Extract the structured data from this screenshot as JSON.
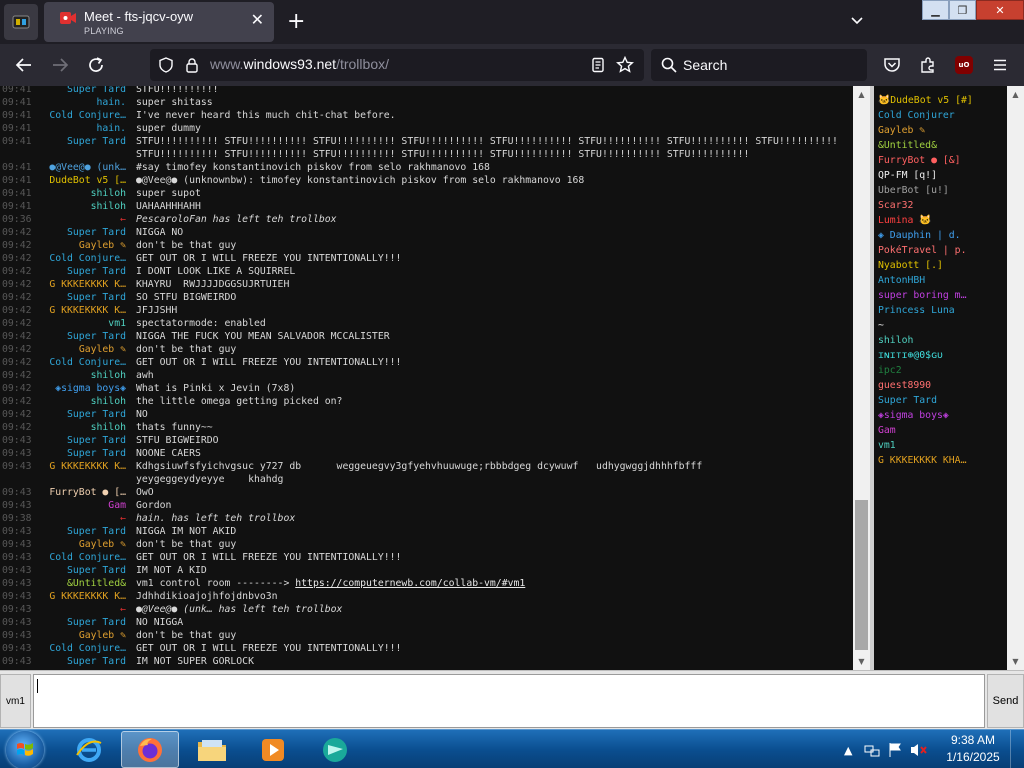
{
  "browser": {
    "tab_title": "Meet - fts-jqcv-oyw",
    "tab_status": "PLAYING",
    "url_prefix": "www.",
    "url_host": "windows93.net",
    "url_path": "/trollbox/",
    "search_placeholder": "Search",
    "ublock_label": "uO"
  },
  "chat": {
    "messages": [
      {
        "time": "09:41",
        "nick": "Super Tard",
        "color": "#2fa6d8",
        "text": "STFU!!!!!!!!!!"
      },
      {
        "time": "09:41",
        "nick": "hain.",
        "color": "#2fa6d8",
        "text": "super shitass"
      },
      {
        "time": "09:41",
        "nick": "Cold Conjure…",
        "color": "#2fa6d8",
        "text": "I've never heard this much chit-chat before."
      },
      {
        "time": "09:41",
        "nick": "hain.",
        "color": "#2fa6d8",
        "text": "super dummy"
      },
      {
        "time": "09:41",
        "nick": "Super Tard",
        "color": "#2fa6d8",
        "text": "STFU!!!!!!!!!! STFU!!!!!!!!!! STFU!!!!!!!!!! STFU!!!!!!!!!! STFU!!!!!!!!!! STFU!!!!!!!!!! STFU!!!!!!!!!! STFU!!!!!!!!!!"
      },
      {
        "time": "",
        "nick": "",
        "color": "#2fa6d8",
        "text": "STFU!!!!!!!!!! STFU!!!!!!!!!! STFU!!!!!!!!!! STFU!!!!!!!!!! STFU!!!!!!!!!! STFU!!!!!!!!!! STFU!!!!!!!!!!"
      },
      {
        "time": "09:41",
        "nick": "●@Vee@● (unk…",
        "color": "#4fa3e0",
        "text": "#say timofey konstantinovich piskov from selo rakhmanovo 168"
      },
      {
        "time": "09:41",
        "nick": "DudeBot v5 […",
        "color": "#e0c000",
        "text": "●@Vee@● (unknownbw): timofey konstantinovich piskov from selo rakhmanovo 168"
      },
      {
        "time": "09:41",
        "nick": "shiloh",
        "color": "#4fd0c0",
        "text": "super supot"
      },
      {
        "time": "09:41",
        "nick": "shiloh",
        "color": "#4fd0c0",
        "text": "UAHAAHHHAHH"
      },
      {
        "time": "09:36",
        "nick": "←",
        "color": "#e03030",
        "text": "PescaroloFan has left teh trollbox",
        "event": true
      },
      {
        "time": "09:42",
        "nick": "Super Tard",
        "color": "#2fa6d8",
        "text": "NIGGA NO"
      },
      {
        "time": "09:42",
        "nick": "Gayleb ✎",
        "color": "#e0a030",
        "text": "don't be that guy"
      },
      {
        "time": "09:42",
        "nick": "Cold Conjure…",
        "color": "#2fa6d8",
        "text": "GET OUT OR I WILL FREEZE YOU INTENTIONALLY!!!"
      },
      {
        "time": "09:42",
        "nick": "Super Tard",
        "color": "#2fa6d8",
        "text": "I DONT LOOK LIKE A SQUIRREL"
      },
      {
        "time": "09:42",
        "nick": "G KKKEKKKK K…",
        "color": "#e0a020",
        "text": "KHAYRU  RWJJJJDGGSUJRTUIEH"
      },
      {
        "time": "09:42",
        "nick": "Super Tard",
        "color": "#2fa6d8",
        "text": "SO STFU BIGWEIRDO"
      },
      {
        "time": "09:42",
        "nick": "G KKKEKKKK K…",
        "color": "#e0a020",
        "text": "JFJJSHH"
      },
      {
        "time": "09:42",
        "nick": "vm1",
        "color": "#4fd0c0",
        "text": "spectatormode: enabled"
      },
      {
        "time": "09:42",
        "nick": "Super Tard",
        "color": "#2fa6d8",
        "text": "NIGGA THE FUCK YOU MEAN SALVADOR MCCALISTER"
      },
      {
        "time": "09:42",
        "nick": "Gayleb ✎",
        "color": "#e0a030",
        "text": "don't be that guy"
      },
      {
        "time": "09:42",
        "nick": "Cold Conjure…",
        "color": "#2fa6d8",
        "text": "GET OUT OR I WILL FREEZE YOU INTENTIONALLY!!!"
      },
      {
        "time": "09:42",
        "nick": "shiloh",
        "color": "#4fd0c0",
        "text": "awh"
      },
      {
        "time": "09:42",
        "nick": "◈sigma boys◈",
        "color": "#40a0f0",
        "text": "What is Pinki x Jevin (7x8)"
      },
      {
        "time": "09:42",
        "nick": "shiloh",
        "color": "#4fd0c0",
        "text": "the little omega getting picked on?"
      },
      {
        "time": "09:42",
        "nick": "Super Tard",
        "color": "#2fa6d8",
        "text": "NO"
      },
      {
        "time": "09:42",
        "nick": "shiloh",
        "color": "#4fd0c0",
        "text": "thats funny~~"
      },
      {
        "time": "09:43",
        "nick": "Super Tard",
        "color": "#2fa6d8",
        "text": "STFU BIGWEIRDO"
      },
      {
        "time": "09:43",
        "nick": "Super Tard",
        "color": "#2fa6d8",
        "text": "NOONE CAERS"
      },
      {
        "time": "09:43",
        "nick": "G KKKEKKKK K…",
        "color": "#e0a020",
        "text": "Kdhgsiuwfsfyichvgsuc y727 db      weggeuegvy3gfyehvhuuwuge;rbbbdgeg dcywuwf   udhygwggjdhhhfbfff"
      },
      {
        "time": "",
        "nick": "",
        "color": "#e0a020",
        "text": "yeygeggeydyeyye    khahdg"
      },
      {
        "time": "09:43",
        "nick": "FurryBot ● […",
        "color": "#f0d0b0",
        "text": "OwO"
      },
      {
        "time": "09:43",
        "nick": "Gam",
        "color": "#d040d0",
        "text": "Gordon"
      },
      {
        "time": "09:38",
        "nick": "←",
        "color": "#e03030",
        "text": "hain. has left teh trollbox",
        "event": true
      },
      {
        "time": "09:43",
        "nick": "Super Tard",
        "color": "#2fa6d8",
        "text": "NIGGA IM NOT AKID"
      },
      {
        "time": "09:43",
        "nick": "Gayleb ✎",
        "color": "#e0a030",
        "text": "don't be that guy"
      },
      {
        "time": "09:43",
        "nick": "Cold Conjure…",
        "color": "#2fa6d8",
        "text": "GET OUT OR I WILL FREEZE YOU INTENTIONALLY!!!"
      },
      {
        "time": "09:43",
        "nick": "Super Tard",
        "color": "#2fa6d8",
        "text": "IM NOT A KID"
      },
      {
        "time": "09:43",
        "nick": "&Untitled&",
        "color": "#a0d040",
        "text": "vm1 control room --------> ",
        "link": "https://computernewb.com/collab-vm/#vm1"
      },
      {
        "time": "09:43",
        "nick": "G KKKEKKKK K…",
        "color": "#e0a020",
        "text": "Jdhhdikioajojhfojdnbvo3n"
      },
      {
        "time": "09:43",
        "nick": "←",
        "color": "#e03030",
        "text": "●@Vee@● (unk… has left teh trollbox",
        "event": true
      },
      {
        "time": "09:43",
        "nick": "Super Tard",
        "color": "#2fa6d8",
        "text": "NO NIGGA"
      },
      {
        "time": "09:43",
        "nick": "Gayleb ✎",
        "color": "#e0a030",
        "text": "don't be that guy"
      },
      {
        "time": "09:43",
        "nick": "Cold Conjure…",
        "color": "#2fa6d8",
        "text": "GET OUT OR I WILL FREEZE YOU INTENTIONALLY!!!"
      },
      {
        "time": "09:43",
        "nick": "Super Tard",
        "color": "#2fa6d8",
        "text": "IM NOT SUPER GORLOCK"
      }
    ]
  },
  "users": [
    {
      "name": "🐱DudeBot v5 [#]",
      "color": "#e0c000"
    },
    {
      "name": "Cold Conjurer",
      "color": "#2fa6d8"
    },
    {
      "name": "Gayleb ✎",
      "color": "#e0a030"
    },
    {
      "name": "&Untitled&",
      "color": "#a0d040"
    },
    {
      "name": "FurryBot ● [&]",
      "color": "#ff6060"
    },
    {
      "name": "QP-FM [q!]",
      "color": "#f0f0f0"
    },
    {
      "name": "UberBot [u!]",
      "color": "#a0a0a0"
    },
    {
      "name": "Scar32",
      "color": "#ff7070"
    },
    {
      "name": "Lumina 🐱",
      "color": "#ff4040"
    },
    {
      "name": "◈ Dauphin | d.",
      "color": "#40a0f0"
    },
    {
      "name": "PokéTravel | p.",
      "color": "#ff7070"
    },
    {
      "name": "Nyabott [.]",
      "color": "#e0c000"
    },
    {
      "name": "AntonHBH",
      "color": "#2fa6d8"
    },
    {
      "name": "super boring m…",
      "color": "#c040e0"
    },
    {
      "name": "Princess Luna",
      "color": "#2fa6d8"
    },
    {
      "name": "~",
      "color": "#f0f0f0"
    },
    {
      "name": "shiloh",
      "color": "#4fd0c0"
    },
    {
      "name": "ɪɴɪᴛɪ⊕@0$ɢᴜ",
      "color": "#40e0e0"
    },
    {
      "name": "ipc2",
      "color": "#208040"
    },
    {
      "name": "guest8990",
      "color": "#ff7070"
    },
    {
      "name": "Super Tard",
      "color": "#2fa6d8"
    },
    {
      "name": "◈sigma boys◈",
      "color": "#c040e0"
    },
    {
      "name": "Gam",
      "color": "#d040d0"
    },
    {
      "name": "vm1",
      "color": "#4fd0c0"
    },
    {
      "name": "G KKKEKKKK KHA…",
      "color": "#e0a020"
    }
  ],
  "input": {
    "room_label": "vm1",
    "send_label": "Send",
    "value": ""
  },
  "taskbar": {
    "time": "9:38 AM",
    "date": "1/16/2025"
  }
}
